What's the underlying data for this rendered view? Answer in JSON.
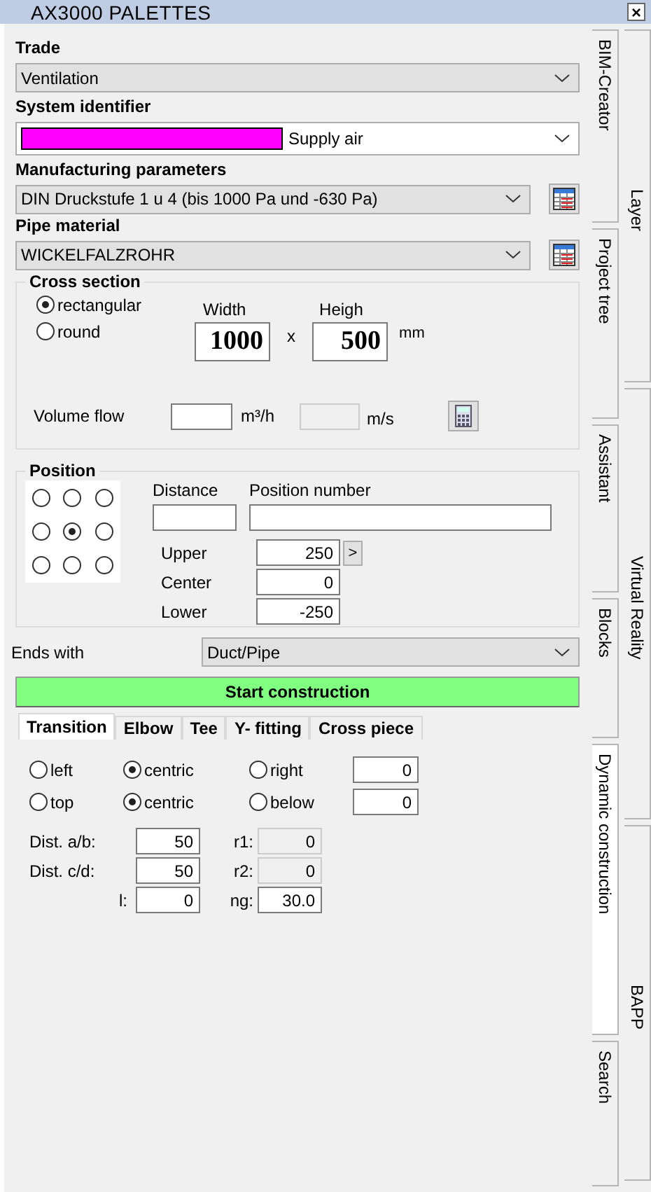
{
  "window": {
    "title": "AX3000 PALETTES",
    "close": "×"
  },
  "trade": {
    "label": "Trade",
    "value": "Ventilation"
  },
  "system_identifier": {
    "label": "System identifier",
    "value": "Supply air",
    "color": "#ff00ff"
  },
  "manufacturing_parameters": {
    "label": "Manufacturing parameters",
    "value": "DIN Druckstufe 1 u 4 (bis 1000 Pa und -630 Pa)"
  },
  "pipe_material": {
    "label": "Pipe material",
    "value": "WICKELFALZROHR"
  },
  "cross_section": {
    "title": "Cross section",
    "shapes": [
      {
        "label": "rectangular",
        "selected": true
      },
      {
        "label": "round",
        "selected": false
      }
    ],
    "width": {
      "label": "Width",
      "value": "1000"
    },
    "separator": "x",
    "height": {
      "label": "Heigh",
      "value": "500"
    },
    "unit": "mm",
    "volume_flow": {
      "label": "Volume flow",
      "unit": "m³/h"
    },
    "velocity": {
      "unit": "m/s",
      "disabled": true
    }
  },
  "position": {
    "title": "Position",
    "anchors": [
      {
        "selected": false
      },
      {
        "selected": false
      },
      {
        "selected": false
      },
      {
        "selected": false
      },
      {
        "selected": true
      },
      {
        "selected": false
      },
      {
        "selected": false
      },
      {
        "selected": false
      },
      {
        "selected": false
      }
    ],
    "distance": {
      "label": "Distance"
    },
    "position_number": {
      "label": "Position number"
    },
    "offsets": [
      {
        "label": "Upper",
        "value": "250"
      },
      {
        "label": "Center",
        "value": "0"
      },
      {
        "label": "Lower",
        "value": "-250"
      }
    ],
    "step_button": ">"
  },
  "ends_with": {
    "label": "Ends with",
    "value": "Duct/Pipe"
  },
  "start_button": "Start construction",
  "tabs": [
    {
      "label": "Transition",
      "selected": true
    },
    {
      "label": "Elbow",
      "selected": false
    },
    {
      "label": "Tee",
      "selected": false
    },
    {
      "label": "Y- fitting",
      "selected": false
    },
    {
      "label": "Cross piece",
      "selected": false
    }
  ],
  "alignment_rows": [
    {
      "options": [
        {
          "label": "left",
          "selected": false
        },
        {
          "label": "centric",
          "selected": true
        },
        {
          "label": "right",
          "selected": false
        }
      ],
      "value": "0"
    },
    {
      "options": [
        {
          "label": "top",
          "selected": false
        },
        {
          "label": "centric",
          "selected": true
        },
        {
          "label": "below",
          "selected": false
        }
      ],
      "value": "0"
    }
  ],
  "parameters": [
    {
      "label": "Dist. a/b:",
      "value": "50",
      "side_label": "r1:",
      "side_value": "0",
      "side_disabled": true
    },
    {
      "label": "Dist. c/d:",
      "value": "50",
      "side_label": "r2:",
      "side_value": "0",
      "side_disabled": true
    },
    {
      "label": "l:",
      "value": "0",
      "side_label": "ng:",
      "side_value": "30.0",
      "side_disabled": false
    }
  ],
  "side_tabs": {
    "inner": [
      {
        "label": "BIM-Creator",
        "selected": false
      },
      {
        "label": "Project tree",
        "selected": false
      },
      {
        "label": "Assistant",
        "selected": false
      },
      {
        "label": "Blocks",
        "selected": false
      },
      {
        "label": "Dynamic construction",
        "selected": true
      },
      {
        "label": "Search",
        "selected": false
      }
    ],
    "outer": [
      {
        "label": "Layer",
        "selected": false
      },
      {
        "label": "Virtual Reality",
        "selected": false
      },
      {
        "label": "BAPP",
        "selected": false
      }
    ]
  }
}
